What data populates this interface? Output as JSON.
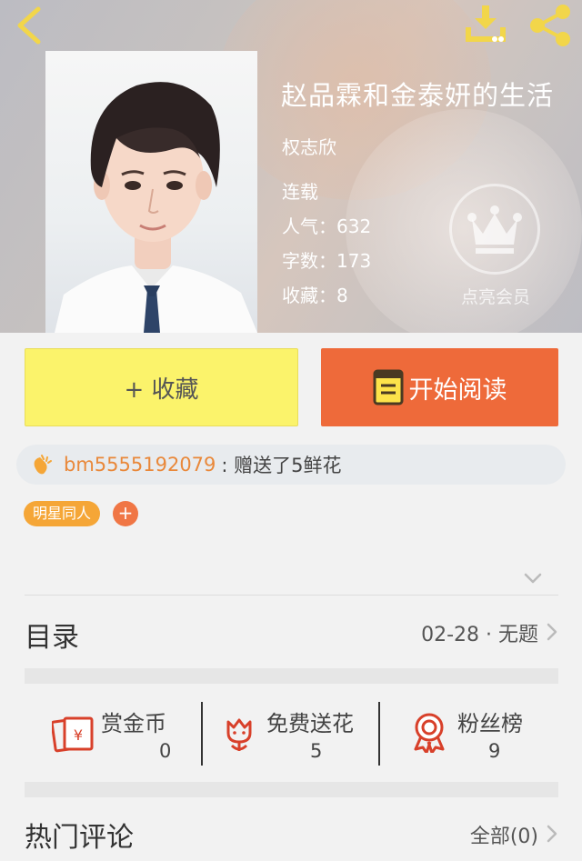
{
  "header": {
    "book_title": "赵品霖和金泰妍的生活",
    "author": "权志欣",
    "status": "连载",
    "popularity_label": "人气：",
    "popularity_value": "632",
    "words_label": "字数：",
    "words_value": "173",
    "favorites_label": "收藏：",
    "favorites_value": "8",
    "vip_label": "点亮会员"
  },
  "buttons": {
    "favorite_label": "+ 收藏",
    "read_label": "开始阅读"
  },
  "gift": {
    "user": "bm5555192079",
    "text": ": 赠送了5鲜花"
  },
  "tags": {
    "items": [
      "明星同人"
    ],
    "add_label": "+"
  },
  "toc": {
    "title": "目录",
    "latest": "02-28 · 无题"
  },
  "actions": [
    {
      "label": "赏金币",
      "value": "0",
      "icon": "red-envelope-icon"
    },
    {
      "label": "免费送花",
      "value": "5",
      "icon": "flower-icon"
    },
    {
      "label": "粉丝榜",
      "value": "9",
      "icon": "medal-icon"
    }
  ],
  "comments": {
    "title": "热门评论",
    "all_label": "全部(0)"
  },
  "colors": {
    "favorite_button": "#fbf36b",
    "read_button": "#ee6a3a",
    "gift_user": "#e9883a",
    "tag": "#f5a637",
    "icon_red": "#d8402a"
  }
}
